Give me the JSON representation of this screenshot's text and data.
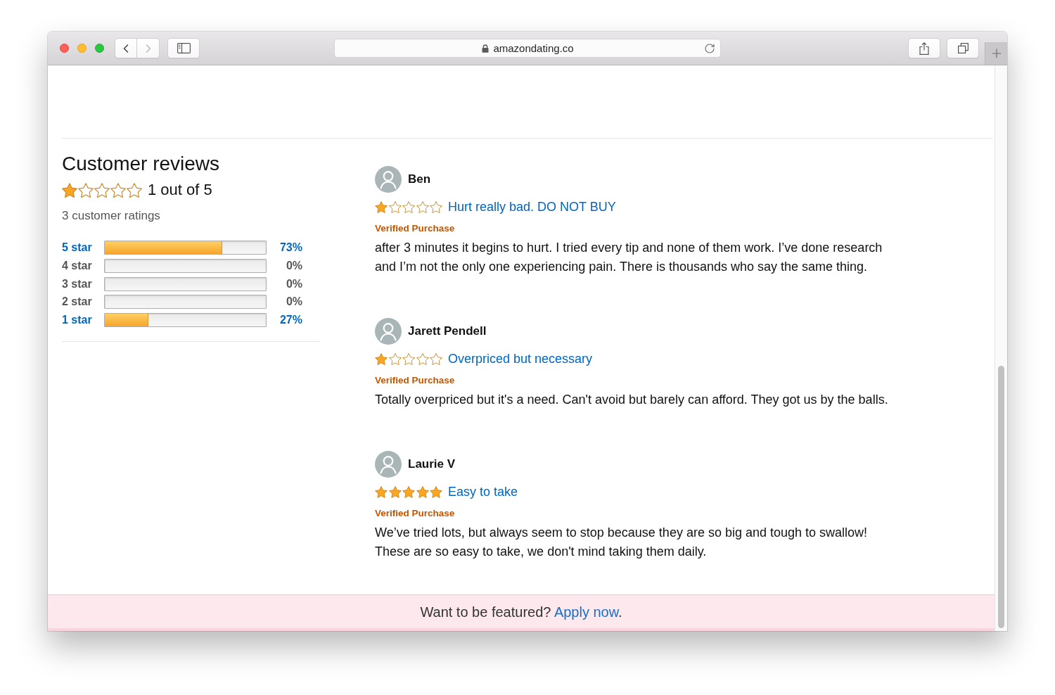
{
  "browser": {
    "navigation": [
      {
        "kind": "back",
        "disabled": false
      },
      {
        "kind": "forward",
        "disabled": true
      }
    ],
    "url": "amazondating.co"
  },
  "summary": {
    "title": "Customer reviews",
    "stars": 1,
    "rating": "1 out of 5",
    "count": "3 customer ratings"
  },
  "histogram": [
    {
      "label": "5 star",
      "level": 0.73,
      "percent": "73%",
      "link": true
    },
    {
      "label": "4 star",
      "level": 0,
      "percent": "0%",
      "link": false
    },
    {
      "label": "3 star",
      "level": 0,
      "percent": "0%",
      "link": false
    },
    {
      "label": "2 star",
      "level": 0,
      "percent": "0%",
      "link": false
    },
    {
      "label": "1 star",
      "level": 0.27,
      "percent": "27%",
      "link": true
    }
  ],
  "reviews": [
    {
      "name": "Ben",
      "stars": 1,
      "title": "Hurt really bad. DO NOT BUY",
      "badge": "Verified Purchase",
      "body": "after 3 minutes it begins to hurt. I tried every tip and none of them work. I’ve done research and I’m not the only one experiencing pain. There is thousands who say the same thing."
    },
    {
      "name": "Jarett Pendell",
      "stars": 1,
      "title": "Overpriced but necessary",
      "badge": "Verified Purchase",
      "body": "Totally overpriced but it's a need. Can't avoid but barely can afford. They got us by the balls."
    },
    {
      "name": "Laurie V",
      "stars": 5,
      "title": "Easy to take",
      "badge": "Verified Purchase",
      "body": "We’ve tried lots, but always seem to stop because they are so big and tough to swallow! These are so easy to take, we don't mind taking them daily."
    }
  ],
  "banner": {
    "text": "Want to be featured?",
    "link": "Apply now",
    "end": "."
  }
}
